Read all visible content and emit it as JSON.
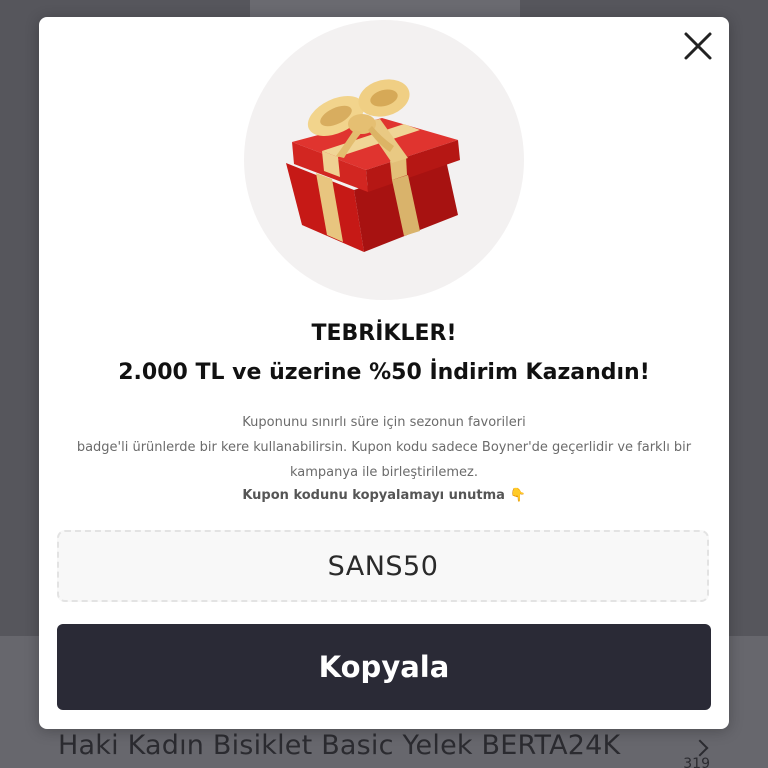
{
  "background": {
    "product_title": "Haki Kadın Bisiklet Basic Yelek BERTA24K",
    "price_fragment": "319"
  },
  "modal": {
    "title": "TEBRİKLER!",
    "subtitle": "2.000 TL ve üzerine %50 İndirim Kazandın!",
    "description_lines": [
      "Kuponunu sınırlı süre için sezonun favorileri",
      "badge'li ürünlerde bir kere kullanabilirsin. Kupon kodu sadece Boyner'de geçerlidir ve farklı bir",
      "kampanya ile birleştirilemez."
    ],
    "reminder": "Kupon kodunu kopyalamayı unutma",
    "reminder_emoji": "👇",
    "coupon_code": "SANS50",
    "copy_button_label": "Kopyala",
    "close_icon": "close-icon",
    "gift_icon": "gift-box-icon"
  },
  "colors": {
    "overlay": "#56565c",
    "modal_bg": "#ffffff",
    "button_bg": "#2a2a36",
    "gift_red": "#d8201e",
    "ribbon_gold": "#e7c27a"
  }
}
